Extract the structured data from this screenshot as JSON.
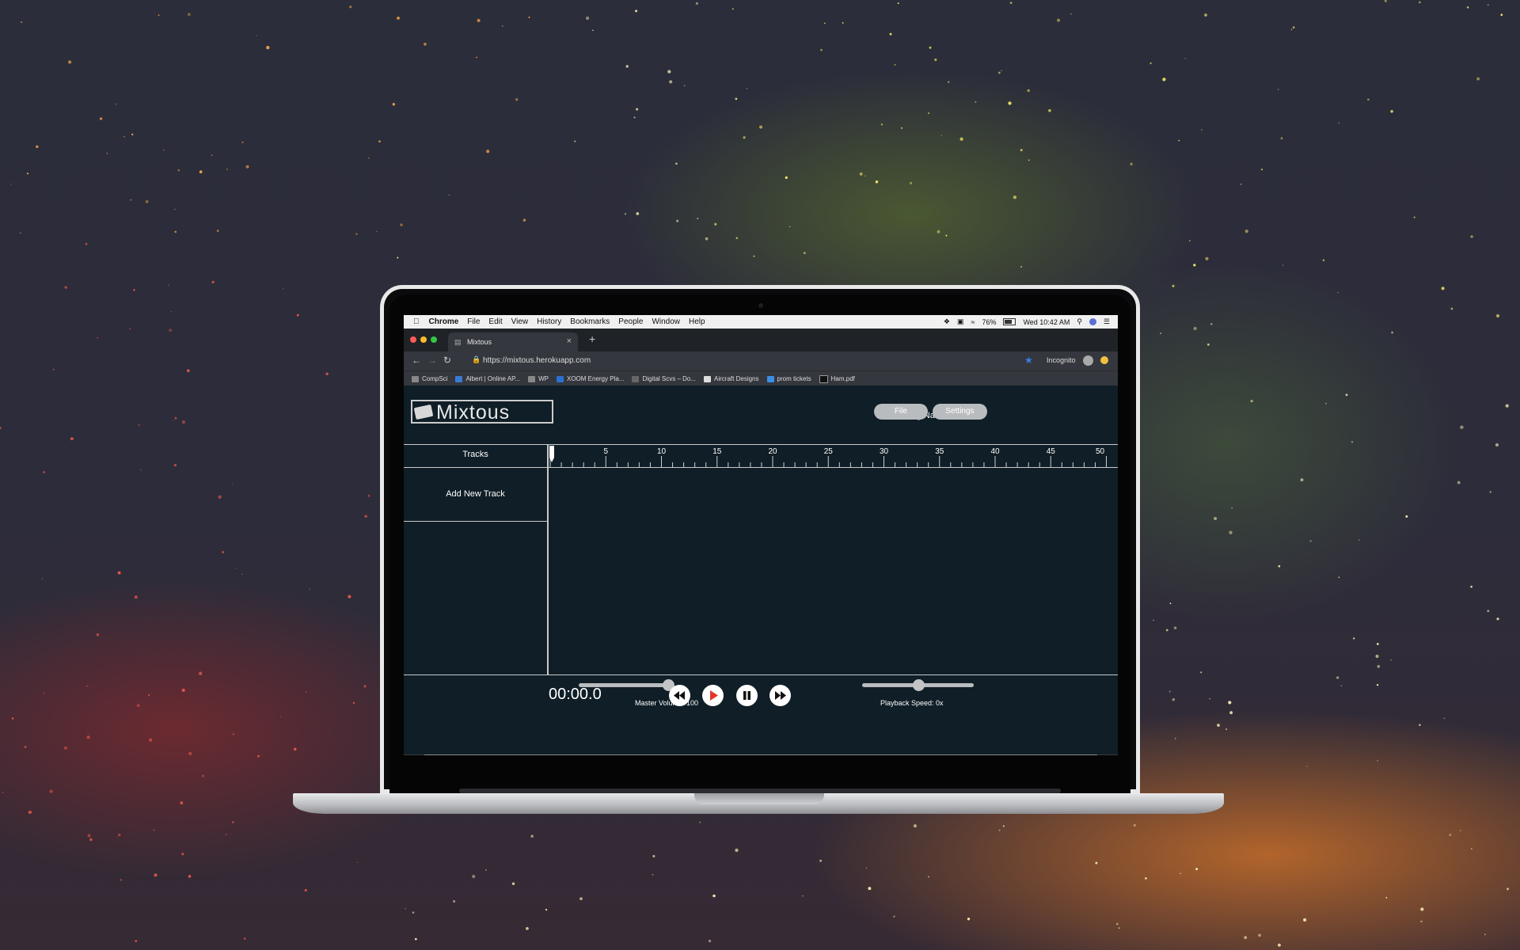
{
  "menubar": {
    "app_name": "Chrome",
    "items": [
      "File",
      "Edit",
      "View",
      "History",
      "Bookmarks",
      "People",
      "Window",
      "Help"
    ],
    "battery": "76%",
    "clock": "Wed 10:42 AM"
  },
  "browser": {
    "tab_title": "Mixtous",
    "url": "https://mixtous.herokuapp.com",
    "incognito_label": "Incognito",
    "bookmarks": [
      "CompSci",
      "Albert | Online AP...",
      "WP",
      "XOOM Energy Pla...",
      "Digital Scvs – Do...",
      "Aircraft Designs",
      "prom tickets",
      "Ham.pdf"
    ]
  },
  "app": {
    "logo_text": "Mixtous",
    "song_name": "Song Name",
    "file_button": "File",
    "settings_button": "Settings",
    "tracks_header": "Tracks",
    "add_track": "Add New Track",
    "ruler_labels": [
      "5",
      "10",
      "15",
      "20",
      "25",
      "30",
      "35",
      "40",
      "45",
      "50"
    ],
    "time": "00:00.0",
    "master_volume_label": "Master Volume: 100",
    "master_volume_value": 100,
    "playback_speed_label": "Playback Speed: 0x",
    "playback_speed_level": 0.5
  },
  "dock": {
    "icon_colors": [
      "#4aa3e8",
      "#6b6fbf",
      "#8a8f99",
      "#3c8c3c",
      "#2a8df0",
      "#4e87d8",
      "#2e7ff0",
      "#e0b43a",
      "#3bb34a",
      "#c99d5a",
      "#f2f2f2",
      "#e35a9a",
      "#f08a2a",
      "#8a2020",
      "#6c6c6c",
      "#2a3b52",
      "#3a3a3a",
      "#e0e0e0",
      "#f0c34a",
      "#36a0f0",
      "#5cb85c",
      "#3fa06a",
      "#c8c8c8",
      "#b0b0b0",
      "#d0d0d0",
      "#a0a0a0",
      "#c0c0c0"
    ]
  },
  "colors": {
    "app_bg": "#0f1e27",
    "button_gray": "#b9bcbf",
    "play_red": "#e5352b"
  }
}
